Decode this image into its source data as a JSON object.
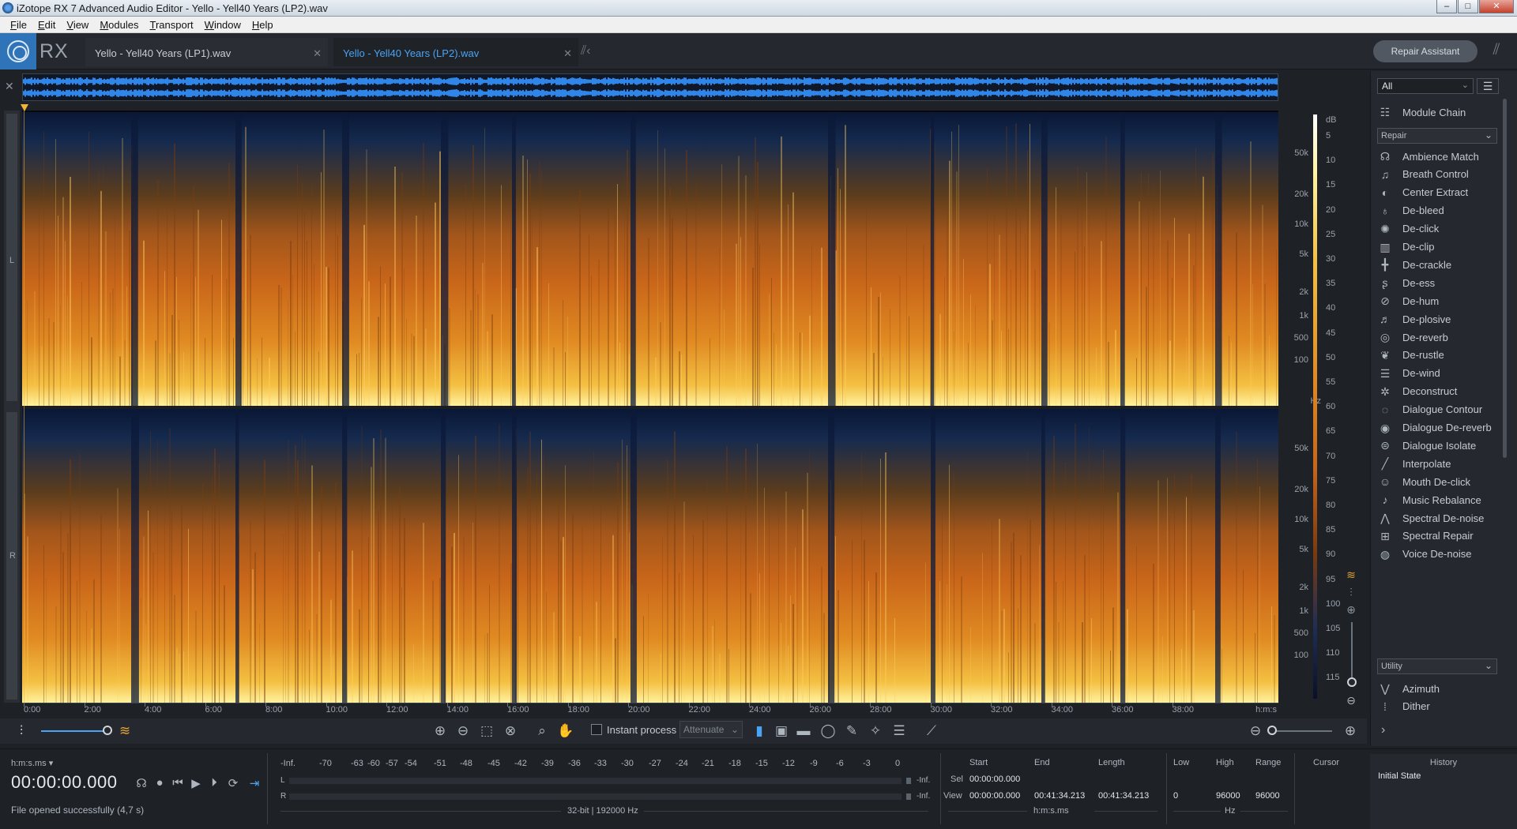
{
  "window": {
    "title": "iZotope RX 7 Advanced Audio Editor - Yello - Yell40 Years (LP2).wav"
  },
  "menu": [
    {
      "u": "F",
      "rest": "ile"
    },
    {
      "u": "E",
      "rest": "dit"
    },
    {
      "u": "V",
      "rest": "iew"
    },
    {
      "u": "M",
      "rest": "odules"
    },
    {
      "u": "T",
      "rest": "ransport"
    },
    {
      "u": "W",
      "rest": "indow"
    },
    {
      "u": "H",
      "rest": "elp"
    }
  ],
  "header": {
    "logo_text": "RX",
    "tabs": [
      {
        "label": "Yello - Yell40 Years (LP1).wav",
        "active": false
      },
      {
        "label": "Yello - Yell40 Years (LP2).wav",
        "active": true
      }
    ],
    "repair_assistant": "Repair Assistant"
  },
  "spectrogram": {
    "channel_labels": [
      "L",
      "R"
    ],
    "freq_ticks": [
      "50k",
      "20k",
      "10k",
      "5k",
      "2k",
      "1k",
      "500",
      "100"
    ],
    "freq_unit": "Hz",
    "db_unit": "dB",
    "db_ticks": [
      "5",
      "10",
      "15",
      "20",
      "25",
      "30",
      "35",
      "40",
      "45",
      "50",
      "55",
      "60",
      "65",
      "70",
      "75",
      "80",
      "85",
      "90",
      "95",
      "100",
      "105",
      "110",
      "115"
    ],
    "time_ticks": [
      "0:00",
      "2:00",
      "4:00",
      "6:00",
      "8:00",
      "10:00",
      "12:00",
      "14:00",
      "16:00",
      "18:00",
      "20:00",
      "22:00",
      "24:00",
      "26:00",
      "28:00",
      "30:00",
      "32:00",
      "34:00",
      "36:00",
      "38:00"
    ],
    "time_unit": "h:m:s",
    "colors": {
      "accent": "#4aa3f5",
      "playhead": "#f0b43a"
    }
  },
  "toolbar": {
    "instant_process": "Instant process",
    "attenuate": "Attenuate"
  },
  "modules": {
    "filter": "All",
    "module_chain": "Module Chain",
    "repair_header": "Repair",
    "repair": [
      {
        "label": "Ambience Match",
        "icon": "ambience-icon",
        "glyph": "☊"
      },
      {
        "label": "Breath Control",
        "icon": "breath-icon",
        "glyph": "♫"
      },
      {
        "label": "Center Extract",
        "icon": "center-icon",
        "glyph": "◐"
      },
      {
        "label": "De-bleed",
        "icon": "debleed-icon",
        "glyph": "♁"
      },
      {
        "label": "De-click",
        "icon": "declick-icon",
        "glyph": "✺"
      },
      {
        "label": "De-clip",
        "icon": "declip-icon",
        "glyph": "▥"
      },
      {
        "label": "De-crackle",
        "icon": "decrackle-icon",
        "glyph": "╋"
      },
      {
        "label": "De-ess",
        "icon": "deess-icon",
        "glyph": "ʂ"
      },
      {
        "label": "De-hum",
        "icon": "dehum-icon",
        "glyph": "⊘"
      },
      {
        "label": "De-plosive",
        "icon": "deplosive-icon",
        "glyph": "♬"
      },
      {
        "label": "De-reverb",
        "icon": "dereverb-icon",
        "glyph": "◎"
      },
      {
        "label": "De-rustle",
        "icon": "derustle-icon",
        "glyph": "❦"
      },
      {
        "label": "De-wind",
        "icon": "dewind-icon",
        "glyph": "☰"
      },
      {
        "label": "Deconstruct",
        "icon": "deconstruct-icon",
        "glyph": "✲"
      },
      {
        "label": "Dialogue Contour",
        "icon": "dialogue-contour-icon",
        "glyph": "◌"
      },
      {
        "label": "Dialogue De-reverb",
        "icon": "dialogue-dereverb-icon",
        "glyph": "◉"
      },
      {
        "label": "Dialogue Isolate",
        "icon": "dialogue-isolate-icon",
        "glyph": "⊜"
      },
      {
        "label": "Interpolate",
        "icon": "interpolate-icon",
        "glyph": "╱"
      },
      {
        "label": "Mouth De-click",
        "icon": "mouth-declick-icon",
        "glyph": "☺"
      },
      {
        "label": "Music Rebalance",
        "icon": "music-rebalance-icon",
        "glyph": "♪"
      },
      {
        "label": "Spectral De-noise",
        "icon": "spectral-denoise-icon",
        "glyph": "⋀"
      },
      {
        "label": "Spectral Repair",
        "icon": "spectral-repair-icon",
        "glyph": "⊞"
      },
      {
        "label": "Voice De-noise",
        "icon": "voice-denoise-icon",
        "glyph": "◍"
      }
    ],
    "utility_header": "Utility",
    "utility": [
      {
        "label": "Azimuth",
        "icon": "azimuth-icon",
        "glyph": "⋁"
      },
      {
        "label": "Dither",
        "icon": "dither-icon",
        "glyph": "⁞"
      }
    ]
  },
  "transport": {
    "format": "h:m:s.ms",
    "timecode": "00:00:00.000",
    "status": "File opened successfully (4,7 s)"
  },
  "meter": {
    "scale": [
      "-Inf.",
      "-70",
      "-63",
      "-60",
      "-57",
      "-54",
      "-51",
      "-48",
      "-45",
      "-42",
      "-39",
      "-36",
      "-33",
      "-30",
      "-27",
      "-24",
      "-21",
      "-18",
      "-15",
      "-12",
      "-9",
      "-6",
      "-3",
      "0"
    ],
    "left_label": "L",
    "right_label": "R",
    "left_inf": "-Inf.",
    "right_inf": "-Inf.",
    "bitdepth": "32-bit | 192000 Hz"
  },
  "selection": {
    "headers": {
      "start": "Start",
      "end": "End",
      "length": "Length",
      "low": "Low",
      "high": "High",
      "range": "Range",
      "cursor": "Cursor"
    },
    "sel_label": "Sel",
    "view_label": "View",
    "sel_start": "00:00:00.000",
    "view_start": "00:00:00.000",
    "view_end": "00:41:34.213",
    "view_length": "00:41:34.213",
    "low": "0",
    "high": "96000",
    "range": "96000",
    "time_unit": "h:m:s.ms",
    "freq_unit": "Hz"
  },
  "history": {
    "title": "History",
    "items": [
      "Initial State"
    ]
  }
}
